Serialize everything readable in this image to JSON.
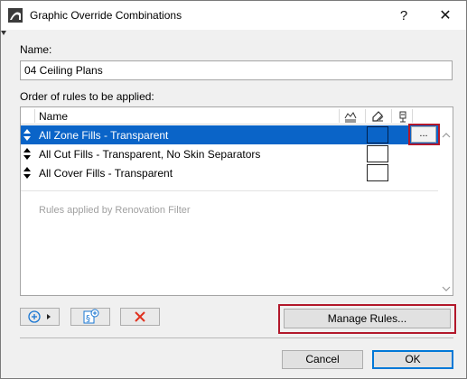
{
  "window": {
    "title": "Graphic Override Combinations",
    "help_label": "?",
    "close_label": "✕"
  },
  "form": {
    "name_label": "Name:",
    "name_value": "04 Ceiling Plans",
    "order_label": "Order of rules to be applied:"
  },
  "list": {
    "header_name": "Name",
    "header_icons": [
      "surface-fill-icon",
      "pen-icon",
      "background-fill-icon"
    ],
    "rows": [
      {
        "label": "All Zone Fills - Transparent",
        "selected": true
      },
      {
        "label": "All Cut Fills - Transparent, No Skin Separators",
        "selected": false
      },
      {
        "label": "All Cover Fills - Transparent",
        "selected": false
      }
    ],
    "row_options_label": "...",
    "renovation_text": "Rules applied by Renovation Filter"
  },
  "toolbar": {
    "add_icon": "add-icon",
    "add_rule_icon": "add-rule-icon",
    "delete_icon": "delete-icon"
  },
  "buttons": {
    "manage_rules": "Manage Rules...",
    "cancel": "Cancel",
    "ok": "OK"
  },
  "colors": {
    "selection": "#0a64c8",
    "highlight_outline": "#b2182b",
    "delete_red": "#e0311f",
    "add_blue": "#1976d2"
  }
}
